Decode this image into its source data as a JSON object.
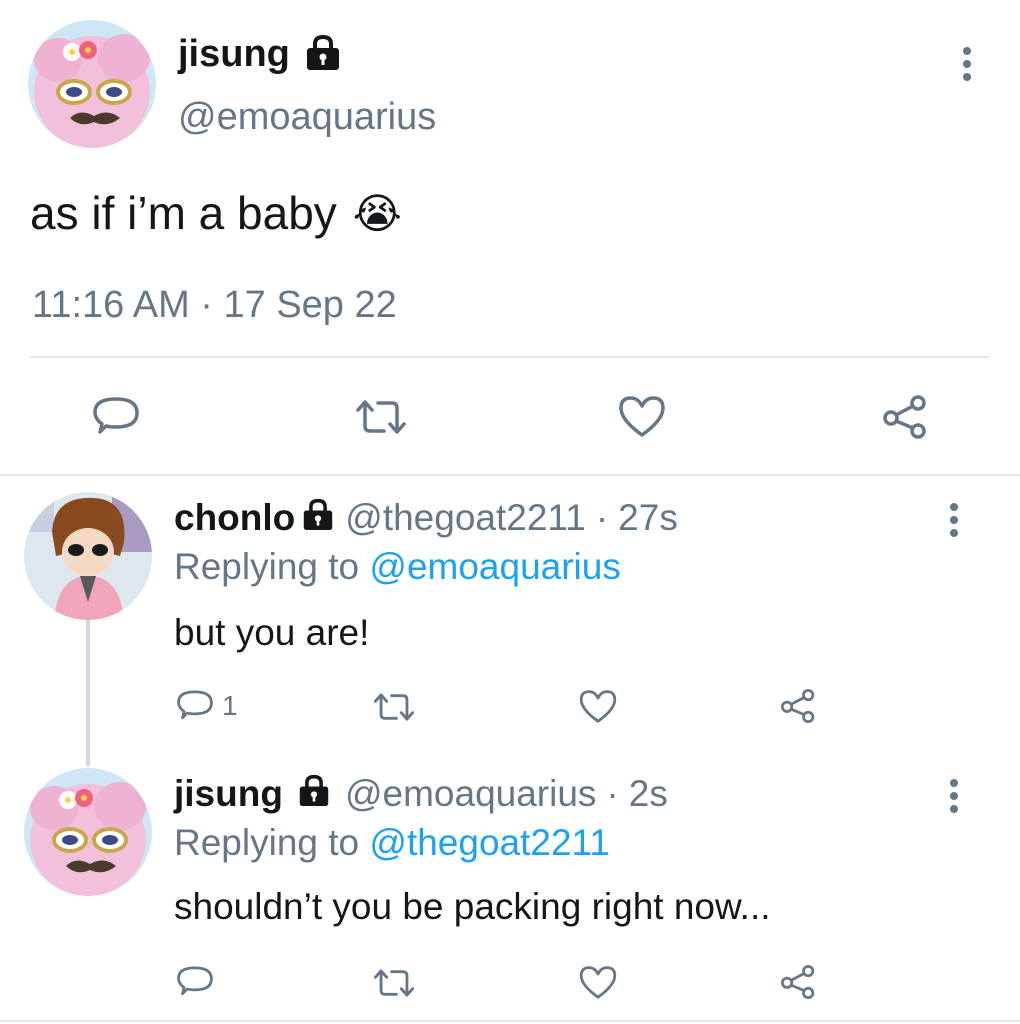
{
  "main_tweet": {
    "display_name": "jisung",
    "handle": "@emoaquarius",
    "text": "as if i’m a baby",
    "emoji": "😭",
    "timestamp": "11:16 AM · 17 Sep 22"
  },
  "replies": [
    {
      "display_name": "chonlo",
      "handle": "@thegoat2211",
      "time": "27s",
      "replying_prefix": "Replying to",
      "replying_to": "@emoaquarius",
      "text": "but you are!",
      "reply_count": "1"
    },
    {
      "display_name": "jisung",
      "handle": "@emoaquarius",
      "time": "2s",
      "replying_prefix": "Replying to",
      "replying_to": "@thegoat2211",
      "text": "shouldn’t you be packing right now...",
      "reply_count": ""
    }
  ],
  "colors": {
    "text": "#14171a",
    "secondary": "#657786",
    "accent": "#1da1f2",
    "divider": "#e1e8ed"
  },
  "icons": [
    "lock-icon",
    "more-icon",
    "reply-icon",
    "retweet-icon",
    "like-icon",
    "share-icon"
  ]
}
